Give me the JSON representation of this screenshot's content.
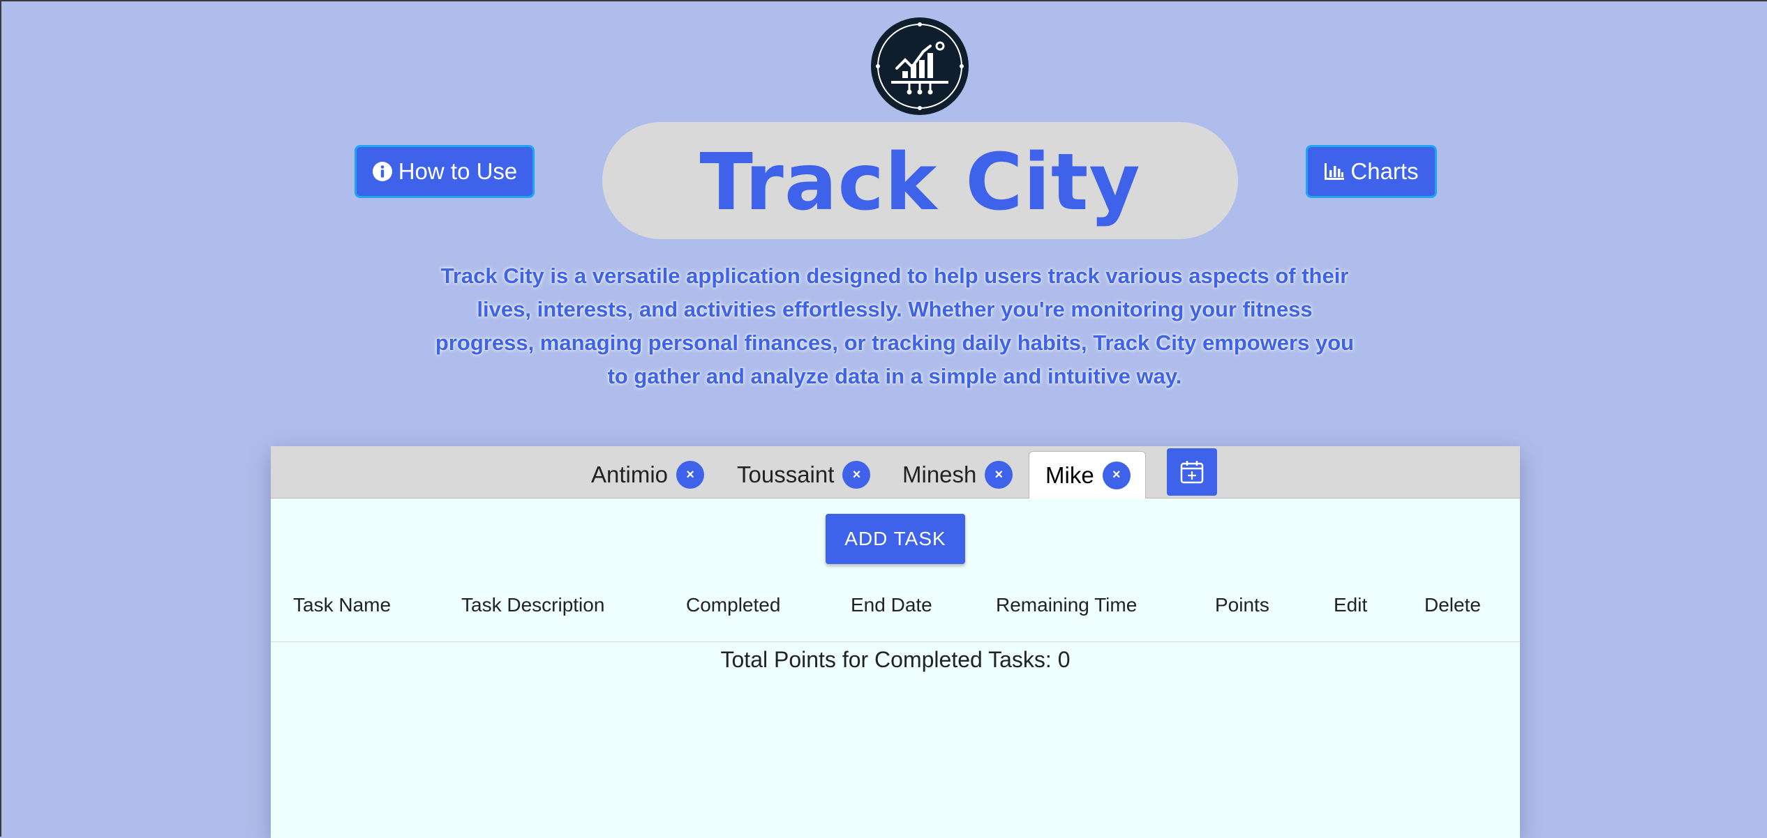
{
  "app": {
    "title": "Track City",
    "description": "Track City is a versatile application designed to help users track various aspects of their lives, interests, and activities effortlessly. Whether you're monitoring your fitness progress, managing personal finances, or tracking daily habits, Track City empowers you to gather and analyze data in a simple and intuitive way."
  },
  "header": {
    "logo_icon": "chart-growth-logo-icon",
    "how_to_use_label": "How to Use",
    "how_to_use_icon": "info-icon",
    "charts_label": "Charts",
    "charts_icon": "bar-chart-icon"
  },
  "tabs": [
    {
      "label": "Antimio",
      "close": "×"
    },
    {
      "label": "Toussaint",
      "close": "×"
    },
    {
      "label": "Minesh",
      "close": "×"
    },
    {
      "label": "Mike",
      "close": "×",
      "active": true
    }
  ],
  "add_calendar_icon": "calendar-add-icon",
  "add_task_label": "ADD TASK",
  "table": {
    "columns": [
      "Task Name",
      "Task Description",
      "Completed",
      "End Date",
      "Remaining Time",
      "Points",
      "Edit",
      "Delete"
    ],
    "rows": []
  },
  "total": {
    "label": "Total Points for Completed Tasks: ",
    "value": "0"
  },
  "colors": {
    "background": "#afbdec",
    "accent": "#3e63ea",
    "panel": "#effffd"
  }
}
